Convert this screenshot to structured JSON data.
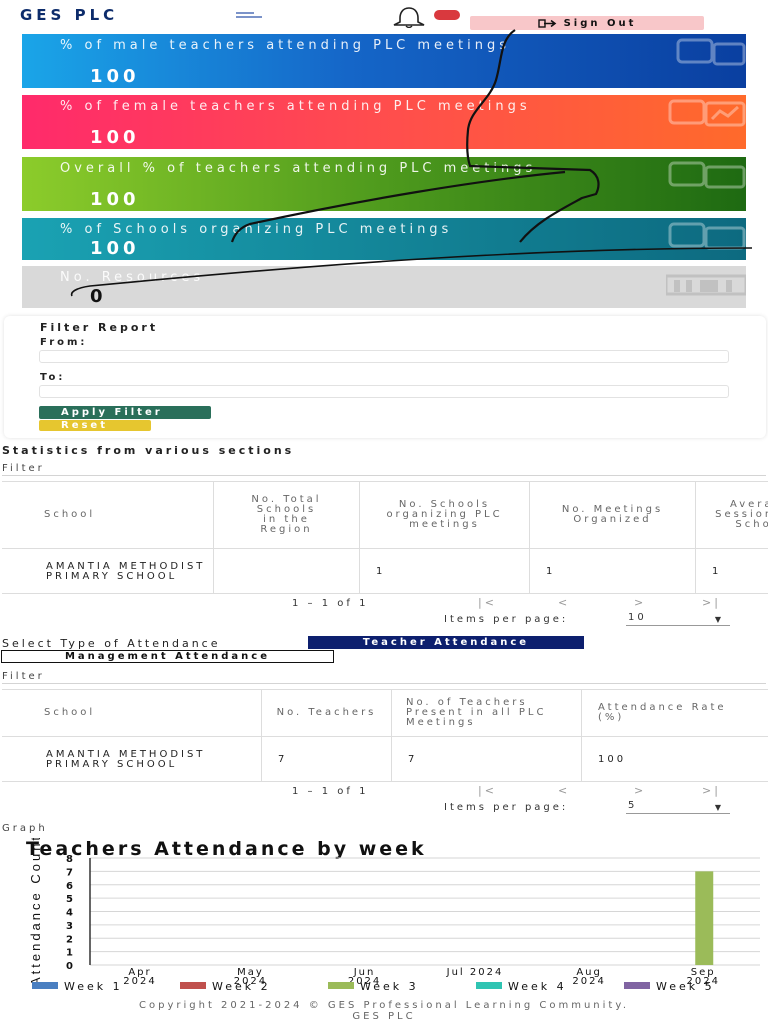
{
  "header": {
    "brand": "GES PLC",
    "sign_out_label": "Sign Out",
    "colors": {
      "brand": "#0d2c6b",
      "badge": "#d9393e",
      "sign_out_bg": "#f8c7c9"
    }
  },
  "stat_cards": [
    {
      "label": "% of male teachers attending PLC meetings",
      "value": "100",
      "icon": "document-icon"
    },
    {
      "label": "% of female teachers attending PLC meetings",
      "value": "100",
      "icon": "chart-icon"
    },
    {
      "label": "Overall % of teachers attending PLC meetings",
      "value": "100",
      "icon": "document-icon"
    },
    {
      "label": "% of Schools organizing PLC meetings",
      "value": "100",
      "icon": "document-icon"
    },
    {
      "label": "No. Resources",
      "value": "0",
      "icon": "library-icon"
    }
  ],
  "filter_report": {
    "title": "Filter Report",
    "from_label": "From:",
    "to_label": "To:",
    "from_value": "",
    "to_value": "",
    "apply_label": "Apply Filter",
    "reset_label": "Reset"
  },
  "statistics_section": {
    "heading": "Statistics from various sections",
    "filter_label": "Filter",
    "columns": [
      "School",
      "No. Total Schools in the Region",
      "No. Schools organizing PLC meetings",
      "No. Meetings Organized",
      "Average Sessions by School"
    ],
    "rows": [
      [
        "AMANTIA METHODIST PRIMARY SCHOOL",
        "",
        "1",
        "1",
        "1"
      ]
    ],
    "pager": {
      "range": "1 – 1 of 1",
      "items_per_page_label": "Items per page:",
      "items_per_page": "10"
    }
  },
  "attendance_type": {
    "label": "Select Type of Attendance",
    "teacher_label": "Teacher Attendance",
    "management_label": "Management Attendance"
  },
  "attendance_table": {
    "filter_label": "Filter",
    "columns": [
      "School",
      "No. Teachers",
      "No. of Teachers Present in all PLC Meetings",
      "Attendance Rate (%)"
    ],
    "rows": [
      [
        "AMANTIA METHODIST PRIMARY SCHOOL",
        "7",
        "7",
        "100"
      ]
    ],
    "pager": {
      "range": "1 – 1 of 1",
      "items_per_page_label": "Items per page:",
      "items_per_page": "5"
    }
  },
  "graph_label": "Graph",
  "chart_data": {
    "type": "bar",
    "title": "Teachers Attendance by week",
    "xlabel": "",
    "ylabel": "Attendance Count",
    "ylim": [
      0,
      8
    ],
    "yticks": [
      0,
      1,
      2,
      3,
      4,
      5,
      6,
      7,
      8
    ],
    "x_tick_labels": [
      "Apr 2024",
      "May 2024",
      "Jun 2024",
      "Jul 2024",
      "Aug 2024",
      "Sep 2024"
    ],
    "grid": true,
    "legend_position": "bottom",
    "series": [
      {
        "name": "Week 1",
        "color": "#4a7fc1",
        "points": []
      },
      {
        "name": "Week 2",
        "color": "#c0504d",
        "points": []
      },
      {
        "name": "Week 3",
        "color": "#9bbb59",
        "points": [
          {
            "x": "2024-09-01",
            "y": 7
          }
        ]
      },
      {
        "name": "Week 4",
        "color": "#2fc4b2",
        "points": []
      },
      {
        "name": "Week 5",
        "color": "#8064a2",
        "points": []
      }
    ]
  },
  "footer": {
    "line1": "Copyright 2021-2024 © GES Professional Learning Community.",
    "line2": "GES PLC"
  }
}
